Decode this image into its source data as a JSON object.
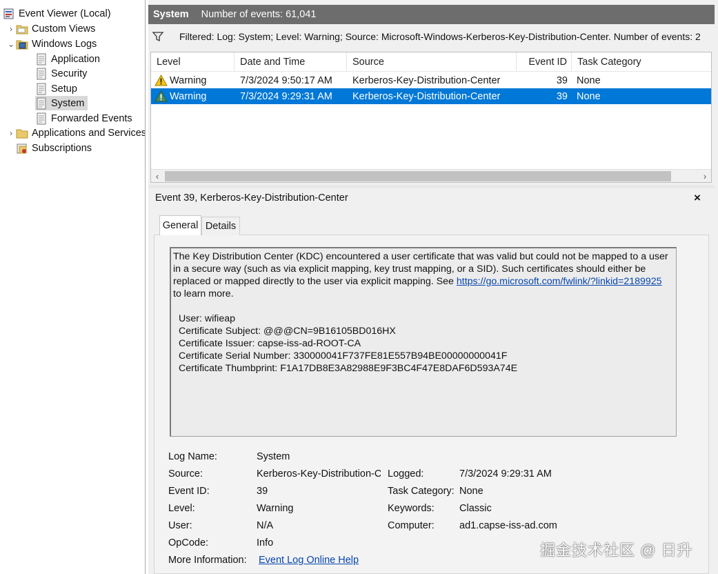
{
  "tree": {
    "root": "Event Viewer (Local)",
    "custom_views": "Custom Views",
    "windows_logs": "Windows Logs",
    "application": "Application",
    "security": "Security",
    "setup": "Setup",
    "system": "System",
    "forwarded_events": "Forwarded Events",
    "apps_services": "Applications and Services Lo",
    "subscriptions": "Subscriptions"
  },
  "header": {
    "title": "System",
    "count": "Number of events: 61,041"
  },
  "filter": {
    "text": "Filtered: Log: System; Level: Warning; Source: Microsoft-Windows-Kerberos-Key-Distribution-Center. Number of events: 2"
  },
  "grid": {
    "columns": {
      "level": "Level",
      "datetime": "Date and Time",
      "source": "Source",
      "eventid": "Event ID",
      "category": "Task Category"
    },
    "rows": [
      {
        "level": "Warning",
        "datetime": "7/3/2024 9:50:17 AM",
        "source": "Kerberos-Key-Distribution-Center",
        "eventid": "39",
        "category": "None"
      },
      {
        "level": "Warning",
        "datetime": "7/3/2024 9:29:31 AM",
        "source": "Kerberos-Key-Distribution-Center",
        "eventid": "39",
        "category": "None"
      }
    ]
  },
  "detail": {
    "title": "Event 39, Kerberos-Key-Distribution-Center",
    "close": "×",
    "tab_general": "General",
    "tab_details": "Details",
    "desc_line1": "The Key Distribution Center (KDC) encountered a user certificate that was valid but could not be mapped to a user in a secure way (such as via explicit mapping, key trust mapping, or a SID). Such certificates should either be replaced or mapped directly to the user via explicit mapping. See ",
    "desc_link": "https://go.microsoft.com/fwlink/?linkid=2189925",
    "desc_line2": "to learn more.",
    "user": "User: wifieap",
    "cert_subject": "Certificate Subject: @@@CN=9B16105BD016HX",
    "cert_issuer": "Certificate Issuer: capse-iss-ad-ROOT-CA",
    "cert_serial": "Certificate Serial Number: 330000041F737FE81E557B94BE00000000041F",
    "cert_thumb": "Certificate Thumbprint: F1A17DB8E3A82988E9F3BC4F47E8DAF6D593A74E"
  },
  "props": {
    "log_name_label": "Log Name:",
    "log_name": "System",
    "source_label": "Source:",
    "source": "Kerberos-Key-Distribution-C",
    "logged_label": "Logged:",
    "logged": "7/3/2024 9:29:31 AM",
    "event_id_label": "Event ID:",
    "event_id": "39",
    "task_category_label": "Task Category:",
    "task_category": "None",
    "level_label": "Level:",
    "level": "Warning",
    "keywords_label": "Keywords:",
    "keywords": "Classic",
    "user_label": "User:",
    "user": "N/A",
    "computer_label": "Computer:",
    "computer": "ad1.capse-iss-ad.com",
    "opcode_label": "OpCode:",
    "opcode": "Info",
    "more_info_label": "More Information:",
    "more_info": "Event Log Online Help"
  },
  "watermark": "掘金技术社区 @ 日升",
  "icons": {
    "root": "event-viewer-icon",
    "folder": "folder-icon",
    "log": "log-icon",
    "warning": "warning-icon",
    "filter": "filter-icon"
  },
  "colors": {
    "selection": "#0078d7",
    "header": "#6d6d6d",
    "link": "#0645ad"
  }
}
